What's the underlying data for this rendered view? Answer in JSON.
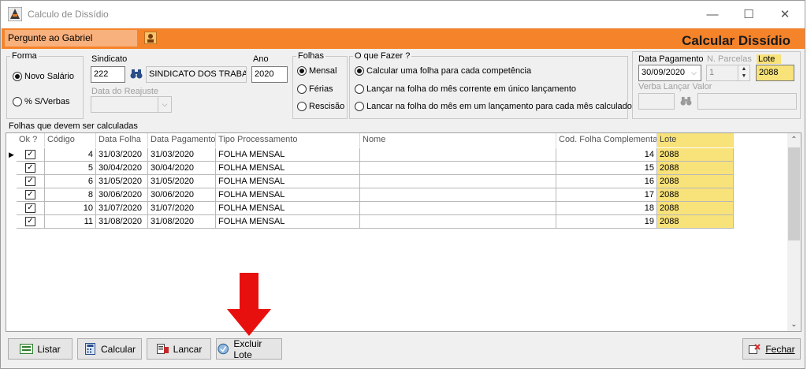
{
  "window": {
    "title": "Calculo de Dissídio",
    "minimize_label": "—",
    "maximize_label": "☐",
    "close_label": "✕"
  },
  "header": {
    "ask_label": "Pergunte ao Gabriel",
    "main_title": "Calcular Dissídio"
  },
  "forma": {
    "legend": "Forma",
    "options": [
      "Novo Salário",
      "% S/Verbas"
    ],
    "selected": "Novo Salário"
  },
  "sindicato": {
    "label": "Sindicato",
    "code": "222",
    "name": "SINDICATO DOS TRABA",
    "ano_label": "Ano",
    "ano": "2020",
    "data_reajuste_label": "Data do Reajuste",
    "data_reajuste": ""
  },
  "folhas": {
    "legend": "Folhas",
    "options": [
      "Mensal",
      "Férias",
      "Rescisão"
    ],
    "selected": "Mensal"
  },
  "o_que_fazer": {
    "legend": "O que Fazer ?",
    "options": [
      "Calcular uma folha para cada competência",
      "Lançar na folha do mês corrente em único lançamento",
      "Lancar na folha do mês em um lançamento para cada mês calculado"
    ],
    "selected": "Calcular uma folha para cada competência"
  },
  "pagamento": {
    "data_label": "Data Pagamento",
    "data": "30/09/2020",
    "parcelas_label": "N. Parcelas",
    "parcelas": "1",
    "lote_label": "Lote",
    "lote": "2088",
    "verba_label": "Verba Lançar Valor",
    "verba": ""
  },
  "grid": {
    "title": "Folhas que devem ser calculadas",
    "columns": [
      "Ok ?",
      "Código",
      "Data Folha",
      "Data Pagamento",
      "Tipo Processamento",
      "Nome",
      "Cod. Folha Complementar",
      "Lote"
    ],
    "rows": [
      {
        "ok": true,
        "codigo": "4",
        "data_folha": "31/03/2020",
        "data_pagamento": "31/03/2020",
        "tipo": "FOLHA MENSAL",
        "nome": "",
        "cod_comp": "14",
        "lote": "2088"
      },
      {
        "ok": true,
        "codigo": "5",
        "data_folha": "30/04/2020",
        "data_pagamento": "30/04/2020",
        "tipo": "FOLHA MENSAL",
        "nome": "",
        "cod_comp": "15",
        "lote": "2088"
      },
      {
        "ok": true,
        "codigo": "6",
        "data_folha": "31/05/2020",
        "data_pagamento": "31/05/2020",
        "tipo": "FOLHA MENSAL",
        "nome": "",
        "cod_comp": "16",
        "lote": "2088"
      },
      {
        "ok": true,
        "codigo": "8",
        "data_folha": "30/06/2020",
        "data_pagamento": "30/06/2020",
        "tipo": "FOLHA MENSAL",
        "nome": "",
        "cod_comp": "17",
        "lote": "2088"
      },
      {
        "ok": true,
        "codigo": "10",
        "data_folha": "31/07/2020",
        "data_pagamento": "31/07/2020",
        "tipo": "FOLHA MENSAL",
        "nome": "",
        "cod_comp": "18",
        "lote": "2088"
      },
      {
        "ok": true,
        "codigo": "11",
        "data_folha": "31/08/2020",
        "data_pagamento": "31/08/2020",
        "tipo": "FOLHA MENSAL",
        "nome": "",
        "cod_comp": "19",
        "lote": "2088"
      }
    ]
  },
  "footer": {
    "listar": "Listar",
    "calcular": "Calcular",
    "lancar": "Lancar",
    "excluir_lote": "Excluir Lote",
    "fechar": "Fechar"
  },
  "colors": {
    "accent_orange": "#f5832a",
    "lote_yellow": "#f8e27a",
    "annotation_red": "#e8100f"
  }
}
